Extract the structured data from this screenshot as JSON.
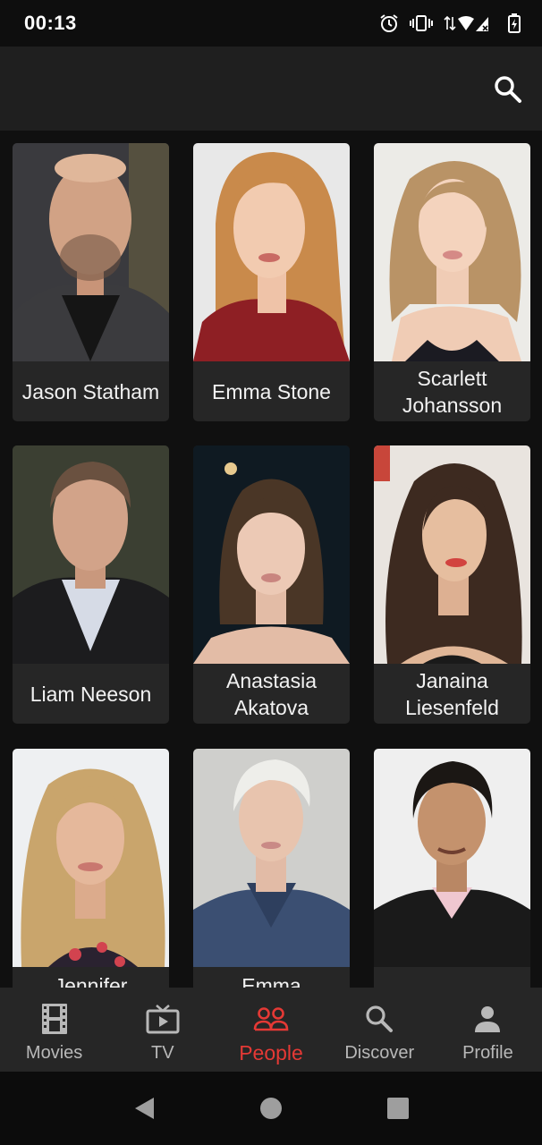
{
  "status_bar": {
    "time": "00:13",
    "icons": [
      "alarm-icon",
      "vibrate-icon",
      "data-arrows-icon",
      "signal-icon",
      "battery-icon"
    ]
  },
  "app_bar": {
    "search_icon": "search-icon"
  },
  "people": [
    {
      "name": "Jason Statham"
    },
    {
      "name": "Emma Stone"
    },
    {
      "name": "Scarlett Johansson"
    },
    {
      "name": "Liam Neeson"
    },
    {
      "name": "Anastasia Akatova"
    },
    {
      "name": "Janaina Liesenfeld"
    },
    {
      "name": "Jennifer"
    },
    {
      "name": "Emma"
    },
    {
      "name": ""
    }
  ],
  "bottom_nav": {
    "items": [
      {
        "label": "Movies",
        "icon": "film-icon"
      },
      {
        "label": "TV",
        "icon": "tv-icon"
      },
      {
        "label": "People",
        "icon": "people-icon",
        "active": true
      },
      {
        "label": "Discover",
        "icon": "search-icon"
      },
      {
        "label": "Profile",
        "icon": "person-icon"
      }
    ]
  },
  "system_nav": {
    "icons": [
      "back-icon",
      "home-icon",
      "recents-icon"
    ]
  },
  "colors": {
    "accent": "#e53935",
    "appbar": "#1f1f1f",
    "background": "#101010",
    "card": "#262626",
    "nav": "#262626"
  }
}
